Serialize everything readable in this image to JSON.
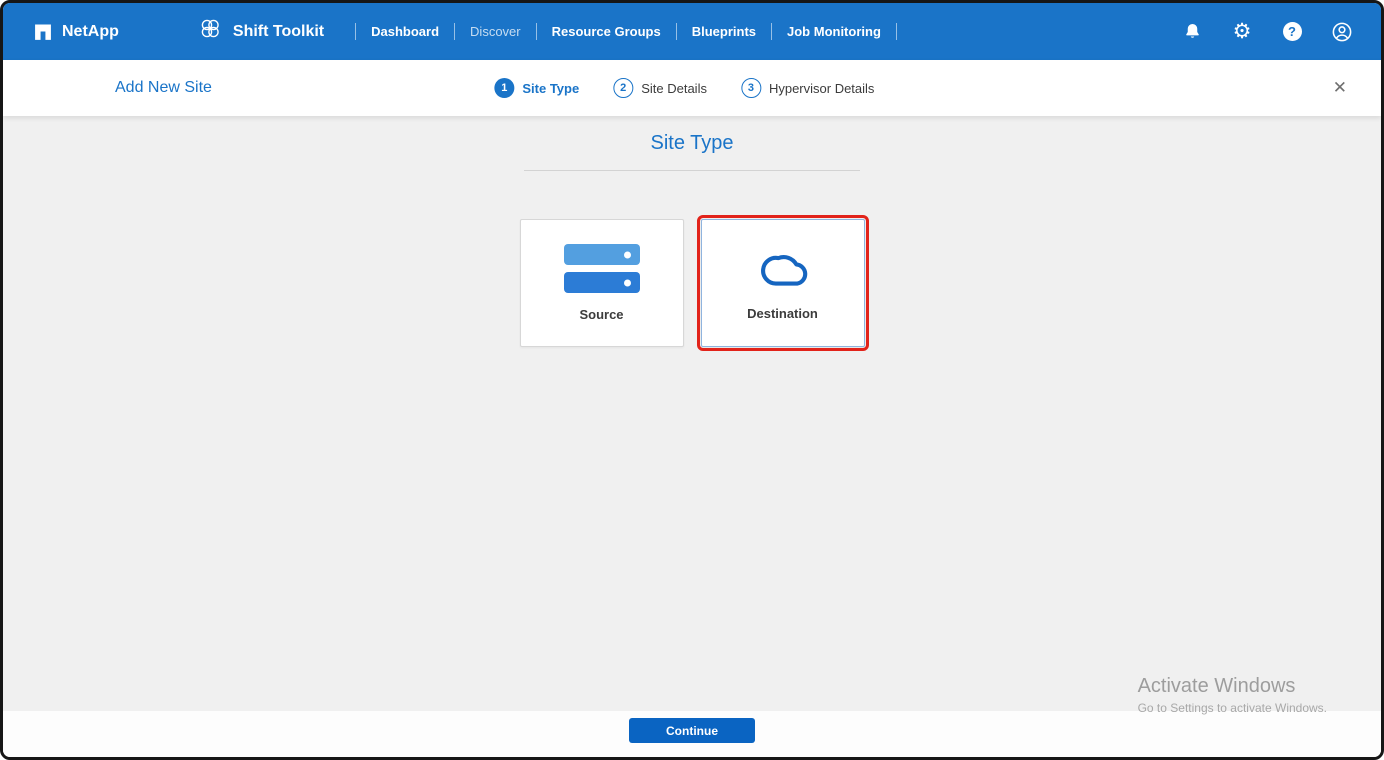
{
  "header": {
    "brand": "NetApp",
    "app_name": "Shift Toolkit",
    "nav": [
      {
        "label": "Dashboard"
      },
      {
        "label": "Discover"
      },
      {
        "label": "Resource Groups"
      },
      {
        "label": "Blueprints"
      },
      {
        "label": "Job Monitoring"
      }
    ],
    "icons": [
      "netapp-logo-icon",
      "shift-toolkit-icon",
      "bell-icon",
      "gear-icon",
      "help-icon",
      "user-icon"
    ]
  },
  "wizard": {
    "title": "Add New Site",
    "close_label": "✕",
    "steps": [
      {
        "number": "1",
        "label": "Site Type",
        "active": true
      },
      {
        "number": "2",
        "label": "Site Details",
        "active": false
      },
      {
        "number": "3",
        "label": "Hypervisor Details",
        "active": false
      }
    ]
  },
  "main": {
    "title": "Site Type",
    "cards": [
      {
        "label": "Source",
        "icon": "server-stack-icon",
        "selected": false
      },
      {
        "label": "Destination",
        "icon": "cloud-icon",
        "selected": true
      }
    ]
  },
  "footer": {
    "continue_label": "Continue"
  },
  "watermark": {
    "line1": "Activate Windows",
    "line2": "Go to Settings to activate Windows."
  },
  "colors": {
    "header_bg": "#1a74c8",
    "accent": "#1a74c8",
    "continue_button": "#0a64c2",
    "selected_outline": "#e2231a",
    "server_top": "#539fe0",
    "server_bottom": "#2c7cd6",
    "cloud_stroke": "#1565c0",
    "content_bg": "#f0f0f0"
  }
}
